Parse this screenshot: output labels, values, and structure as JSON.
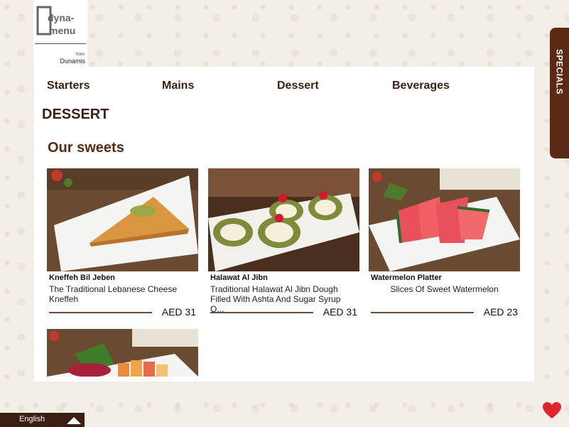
{
  "brand": {
    "logo_text": "dyna-menu",
    "from_label": "from",
    "company": "Dunamis"
  },
  "nav": {
    "items": [
      "Starters",
      "Mains",
      "Dessert",
      "Beverages"
    ]
  },
  "section": {
    "title": "DESSERT",
    "subtitle": "Our sweets"
  },
  "items": [
    {
      "name": "Kneffeh Bil Jeben",
      "description": "The Traditional Lebanese Cheese Kneffeh",
      "price": "AED 31",
      "photo": "kneffeh-photo"
    },
    {
      "name": "Halawat Al Jibn",
      "description": "Traditional Halawat Al Jibn Dough Filled With Ashta And Sugar Syrup O...",
      "price": "AED 31",
      "photo": "halawat-photo"
    },
    {
      "name": "Watermelon Platter",
      "description": "Slices Of Sweet Watermelon",
      "price": "AED 23",
      "photo": "watermelon-photo"
    },
    {
      "photo": "fruit-platter-photo"
    }
  ],
  "specials_tab": "SPECIALS",
  "language": {
    "current": "English",
    "toggle_icon": "caret-up-icon"
  },
  "favorites_icon": "heart-icon",
  "colors": {
    "brand_brown": "#5a2a14",
    "dark_brown": "#3b1f12",
    "heart_red": "#e0262d"
  }
}
